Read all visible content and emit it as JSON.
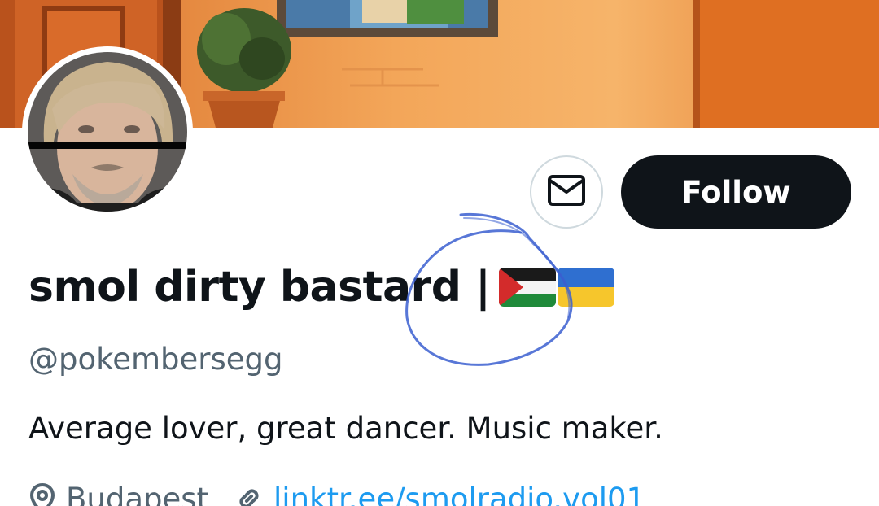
{
  "profile": {
    "display_name": "smol dirty bastard |",
    "handle": "@pokembersegg",
    "bio": "Average lover, great dancer. Music maker.",
    "location": "Budapest",
    "link": "linktr.ee/smolradio.vol01",
    "flags": [
      "palestine-flag",
      "ukraine-flag"
    ]
  },
  "actions": {
    "follow_label": "Follow",
    "message_icon": "mail-icon"
  },
  "icons": {
    "location": "location-pin-icon",
    "link": "link-icon"
  },
  "colors": {
    "text_primary": "#0f1419",
    "text_secondary": "#536471",
    "link": "#1d9bf0",
    "follow_bg": "#0f1419",
    "annotation_ink": "#3b5fd0"
  }
}
